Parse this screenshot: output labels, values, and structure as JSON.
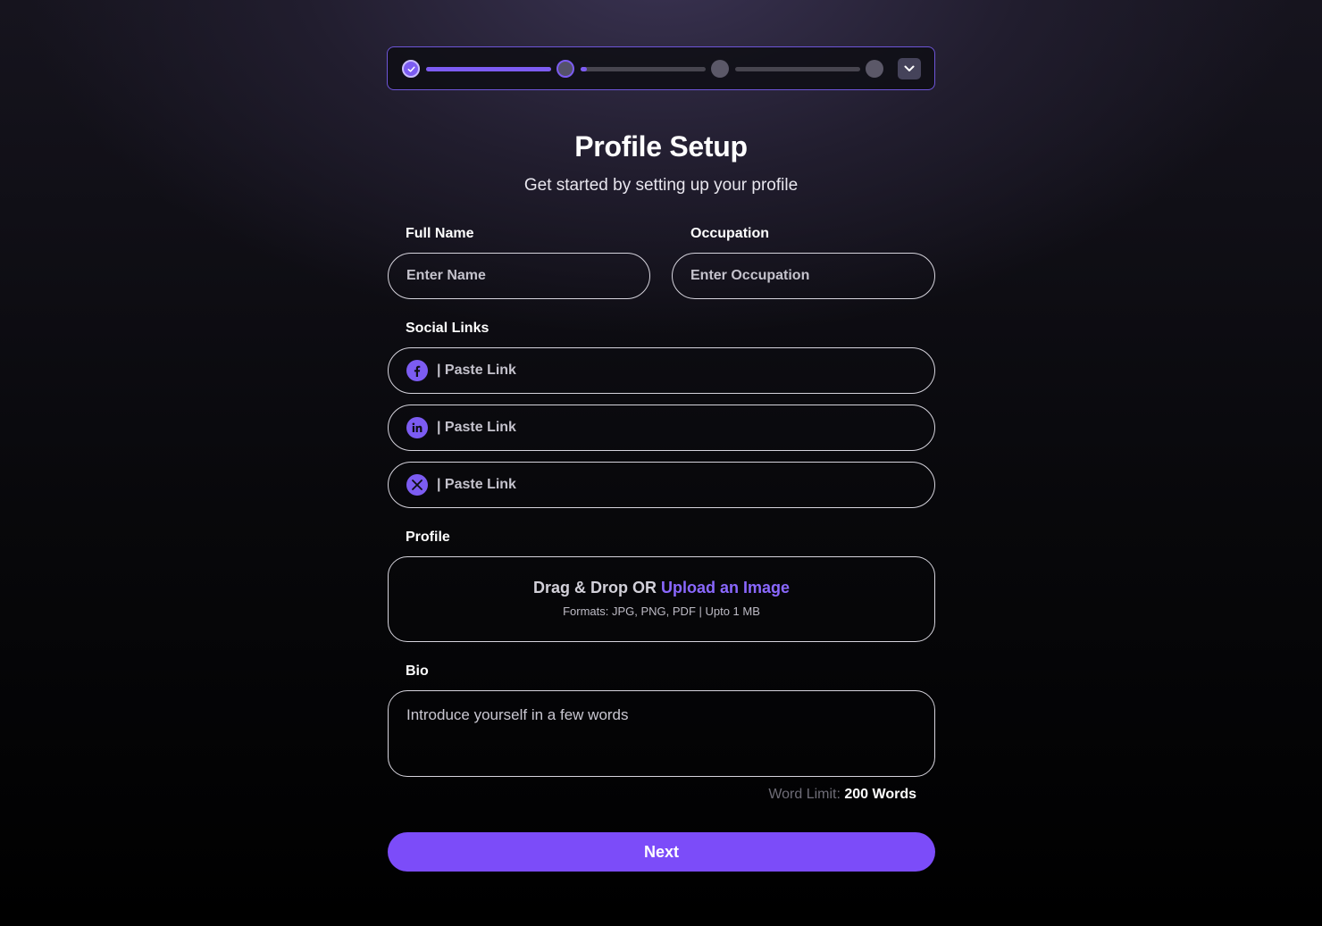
{
  "stepper": {
    "steps": [
      {
        "status": "complete"
      },
      {
        "status": "current"
      },
      {
        "status": "pending"
      },
      {
        "status": "pending"
      }
    ],
    "connector_progress": [
      1.0,
      0.05,
      0.0
    ],
    "expand_icon": "chevron-down-icon"
  },
  "header": {
    "title": "Profile Setup",
    "subtitle": "Get started by setting up your profile"
  },
  "form": {
    "full_name": {
      "label": "Full Name",
      "placeholder": "Enter Name"
    },
    "occupation": {
      "label": "Occupation",
      "placeholder": "Enter Occupation"
    },
    "social_links": {
      "label": "Social Links",
      "items": [
        {
          "icon": "facebook-icon",
          "placeholder": "| Paste Link"
        },
        {
          "icon": "linkedin-icon",
          "placeholder": "| Paste Link"
        },
        {
          "icon": "x-twitter-icon",
          "placeholder": "| Paste Link"
        }
      ]
    },
    "profile": {
      "label": "Profile",
      "drop_text": "Drag & Drop OR",
      "upload_link": "Upload an Image",
      "formats_text": "Formats: JPG, PNG, PDF | Upto 1 MB"
    },
    "bio": {
      "label": "Bio",
      "placeholder": "Introduce yourself in a few words",
      "word_limit_label": "Word Limit:",
      "word_limit_value": "200 Words"
    },
    "next_label": "Next"
  },
  "colors": {
    "accent": "#7c4cf9",
    "link": "#8a68ff",
    "border": "#d6d4dd"
  }
}
